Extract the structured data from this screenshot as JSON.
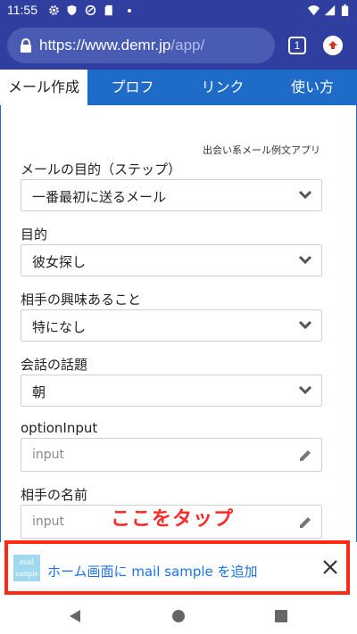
{
  "status_bar": {
    "time": "11:55",
    "left_icons": [
      "gear-icon",
      "shield-icon",
      "vpn-icon",
      "sd-card-icon",
      "dot-icon"
    ],
    "right_icons": [
      "wifi-icon",
      "signal-icon",
      "battery-icon"
    ]
  },
  "browser": {
    "url_host": "https://www.demr.jp",
    "url_path": "/app/",
    "tab_count": "1",
    "accent_color": "#303f9f"
  },
  "site_nav": {
    "tabs": [
      {
        "label": "メール作成",
        "active": true
      },
      {
        "label": "プロフ",
        "active": false
      },
      {
        "label": "リンク",
        "active": false
      },
      {
        "label": "使い方",
        "active": false
      }
    ],
    "color": "#1e6cc8"
  },
  "form": {
    "app_name": "出会い系メール例文アプリ",
    "fields": [
      {
        "label": "メールの目的（ステップ）",
        "value": "一番最初に送るメール"
      },
      {
        "label": "目的",
        "value": "彼女探し"
      },
      {
        "label": "相手の興味あること",
        "value": "特になし"
      },
      {
        "label": "会話の話題",
        "value": "朝"
      }
    ],
    "inputs": [
      {
        "label": "optionInput",
        "placeholder": "input"
      },
      {
        "label": "相手の名前",
        "placeholder": "input"
      }
    ],
    "annotation": "ここをタップ"
  },
  "a2hs_banner": {
    "icon_text": "mail sample",
    "message": "ホーム画面に mail sample を追加",
    "highlight_color": "#ff2a14"
  },
  "nav_bar": {
    "buttons": [
      "back-icon",
      "home-icon",
      "recents-icon"
    ]
  }
}
